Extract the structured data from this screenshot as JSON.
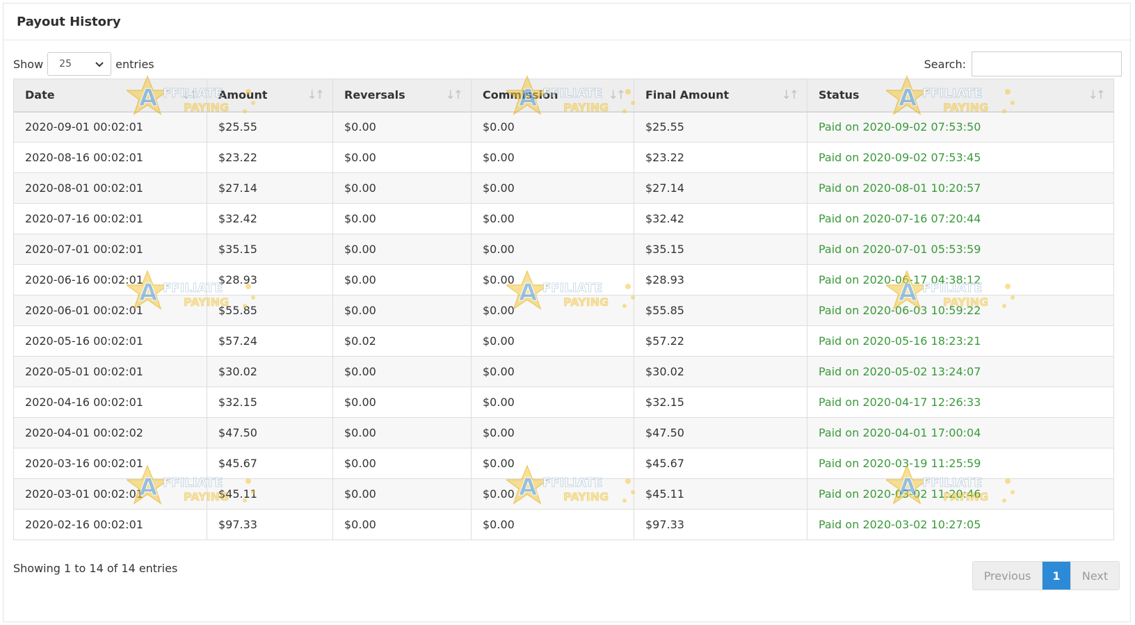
{
  "panel": {
    "title": "Payout History"
  },
  "length_control": {
    "show_label": "Show",
    "value": "25",
    "entries_label": "entries"
  },
  "search": {
    "label": "Search:",
    "value": "",
    "placeholder": ""
  },
  "table": {
    "columns": [
      "Date",
      "Amount",
      "Reversals",
      "Commission",
      "Final Amount",
      "Status"
    ],
    "rows": [
      [
        "2020-09-01 00:02:01",
        "$25.55",
        "$0.00",
        "$0.00",
        "$25.55",
        "Paid on 2020-09-02 07:53:50"
      ],
      [
        "2020-08-16 00:02:01",
        "$23.22",
        "$0.00",
        "$0.00",
        "$23.22",
        "Paid on 2020-09-02 07:53:45"
      ],
      [
        "2020-08-01 00:02:01",
        "$27.14",
        "$0.00",
        "$0.00",
        "$27.14",
        "Paid on 2020-08-01 10:20:57"
      ],
      [
        "2020-07-16 00:02:01",
        "$32.42",
        "$0.00",
        "$0.00",
        "$32.42",
        "Paid on 2020-07-16 07:20:44"
      ],
      [
        "2020-07-01 00:02:01",
        "$35.15",
        "$0.00",
        "$0.00",
        "$35.15",
        "Paid on 2020-07-01 05:53:59"
      ],
      [
        "2020-06-16 00:02:01",
        "$28.93",
        "$0.00",
        "$0.00",
        "$28.93",
        "Paid on 2020-06-17 04:38:12"
      ],
      [
        "2020-06-01 00:02:01",
        "$55.85",
        "$0.00",
        "$0.00",
        "$55.85",
        "Paid on 2020-06-03 10:59:22"
      ],
      [
        "2020-05-16 00:02:01",
        "$57.24",
        "$0.02",
        "$0.00",
        "$57.22",
        "Paid on 2020-05-16 18:23:21"
      ],
      [
        "2020-05-01 00:02:01",
        "$30.02",
        "$0.00",
        "$0.00",
        "$30.02",
        "Paid on 2020-05-02 13:24:07"
      ],
      [
        "2020-04-16 00:02:01",
        "$32.15",
        "$0.00",
        "$0.00",
        "$32.15",
        "Paid on 2020-04-17 12:26:33"
      ],
      [
        "2020-04-01 00:02:02",
        "$47.50",
        "$0.00",
        "$0.00",
        "$47.50",
        "Paid on 2020-04-01 17:00:04"
      ],
      [
        "2020-03-16 00:02:01",
        "$45.67",
        "$0.00",
        "$0.00",
        "$45.67",
        "Paid on 2020-03-19 11:25:59"
      ],
      [
        "2020-03-01 00:02:01",
        "$45.11",
        "$0.00",
        "$0.00",
        "$45.11",
        "Paid on 2020-03-02 11:20:46"
      ],
      [
        "2020-02-16 00:02:01",
        "$97.33",
        "$0.00",
        "$0.00",
        "$97.33",
        "Paid on 2020-03-02 10:27:05"
      ]
    ]
  },
  "footer": {
    "info": "Showing 1 to 14 of 14 entries"
  },
  "pagination": {
    "previous": "Previous",
    "current": "1",
    "next": "Next"
  },
  "watermark": {
    "line1": "AFFILIATE",
    "line2": "PAYING"
  },
  "colors": {
    "status_paid": "#3a9a3a",
    "pager_active": "#2d8ad6",
    "header_bg": "#eeeeee"
  },
  "icons": {
    "sort": "sort-icon",
    "dropdown": "chevron-down-icon",
    "watermark_star": "star-icon"
  }
}
